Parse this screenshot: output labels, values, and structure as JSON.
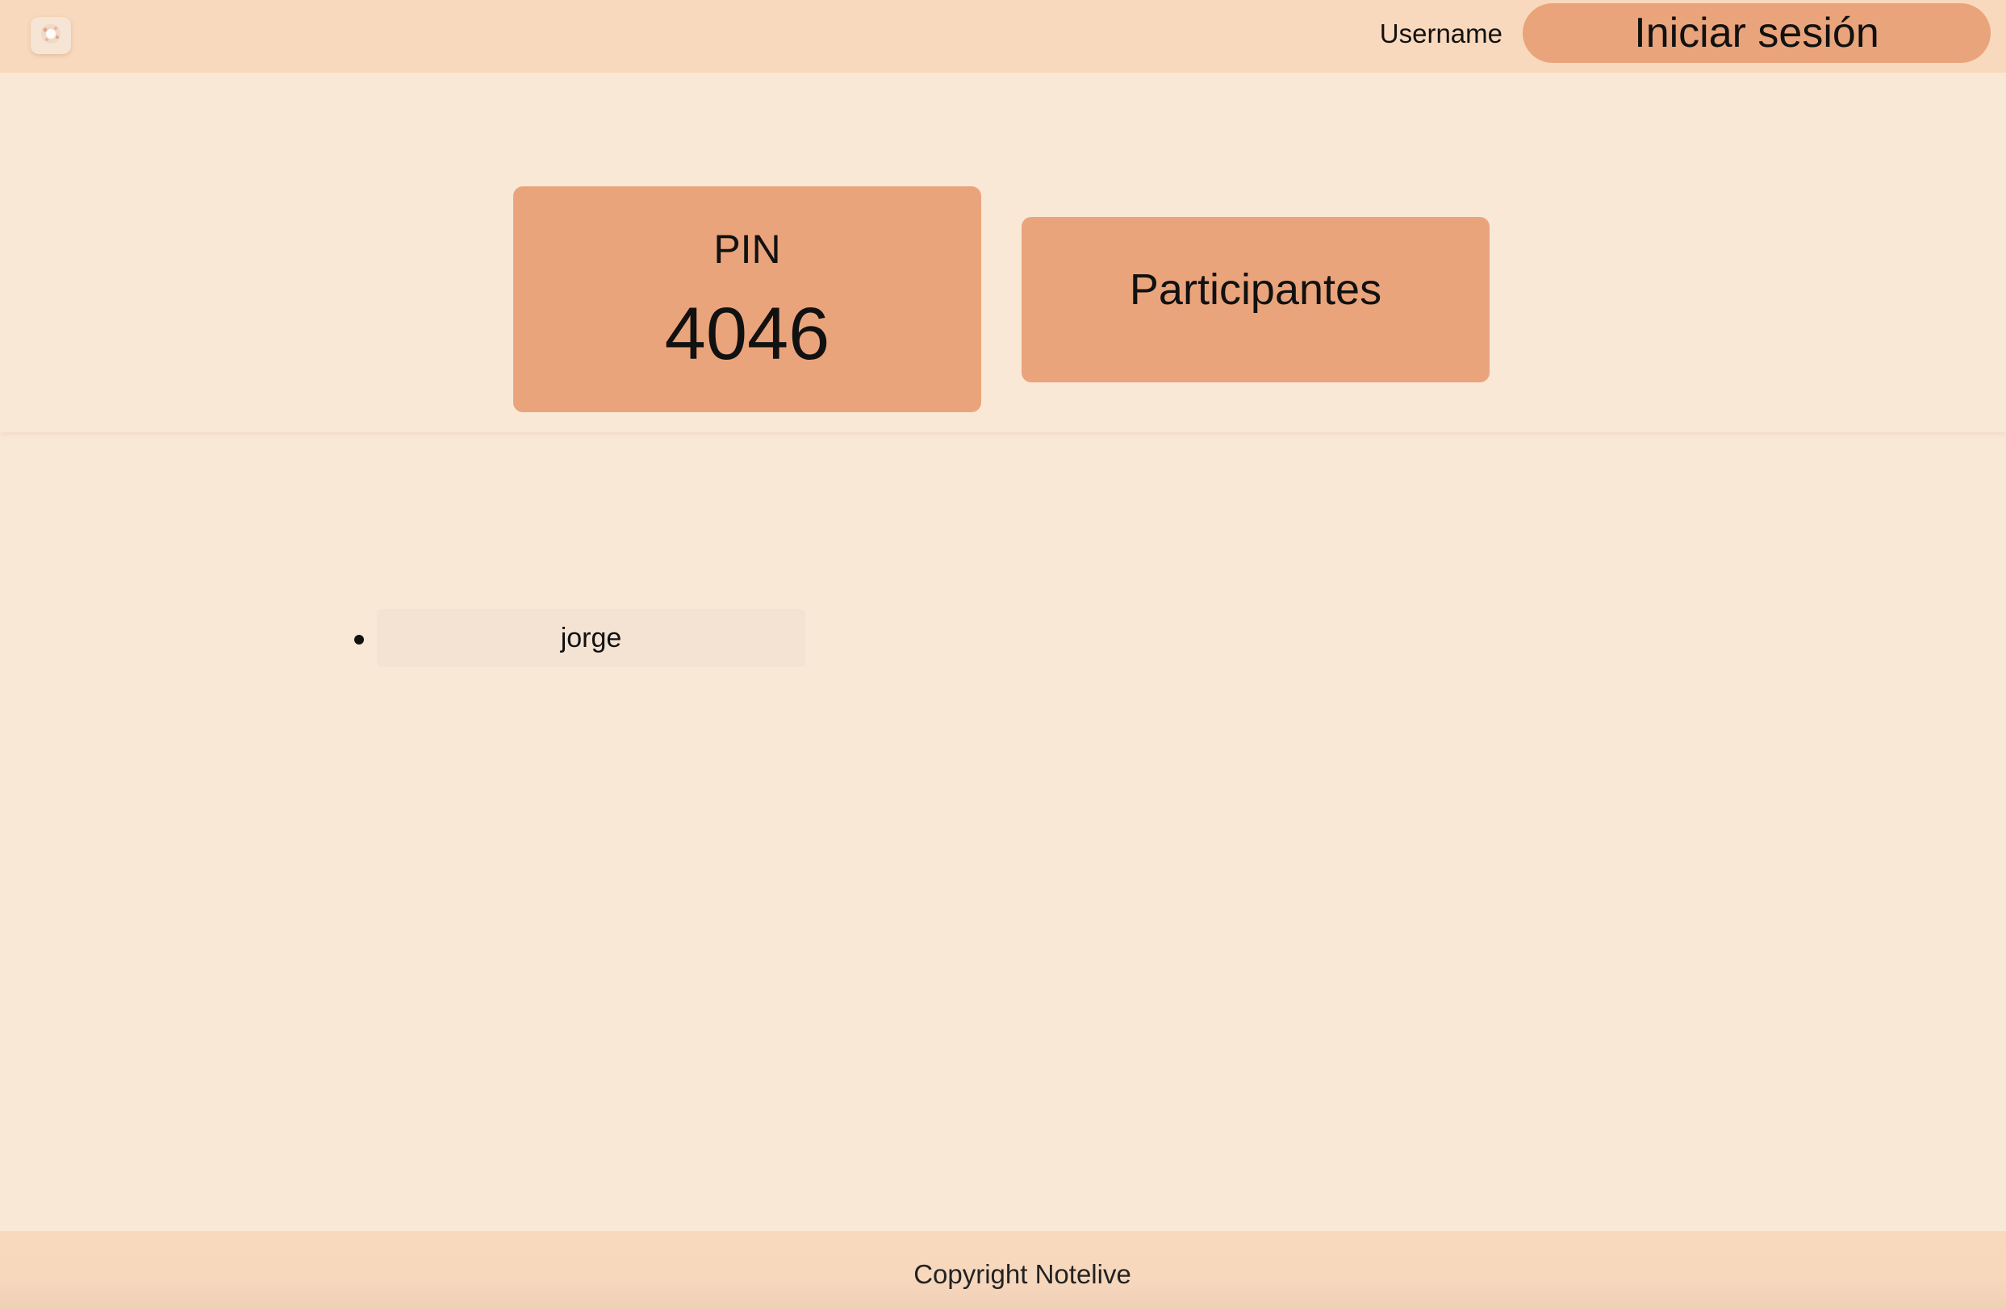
{
  "header": {
    "logo_icon": "palette-logo-icon",
    "username_label": "Username",
    "login_button_label": "Iniciar sesión"
  },
  "hero": {
    "pin": {
      "label": "PIN",
      "value": "4046"
    },
    "participants_button_label": "Participantes"
  },
  "participants": {
    "items": [
      {
        "name": "jorge"
      }
    ]
  },
  "footer": {
    "copyright": "Copyright Notelive"
  },
  "colors": {
    "header_background": "#f9d9bd",
    "page_background": "#fae8d7",
    "accent": "#eaa47b",
    "list_item_background": "#f4e3d3"
  }
}
